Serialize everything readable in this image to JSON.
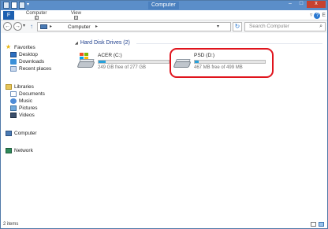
{
  "window": {
    "title": "Computer"
  },
  "ribbon": {
    "file_label": "F",
    "tabs": [
      {
        "label": "Computer",
        "keytip": "C"
      },
      {
        "label": "View",
        "keytip": "V"
      }
    ],
    "help_keytip": "E"
  },
  "address": {
    "path": [
      "Computer"
    ],
    "search_placeholder": "Search Computer"
  },
  "sidebar": {
    "favorites": {
      "label": "Favorites",
      "items": [
        "Desktop",
        "Downloads",
        "Recent places"
      ]
    },
    "libraries": {
      "label": "Libraries",
      "items": [
        "Documents",
        "Music",
        "Pictures",
        "Videos"
      ]
    },
    "computer": "Computer",
    "network": "Network"
  },
  "content": {
    "group_header": "Hard Disk Drives (2)",
    "drives": [
      {
        "name": "ACER (C:)",
        "free_text": "249 GB free of 277 GB",
        "used_fraction": 0.1,
        "has_windows_logo": true
      },
      {
        "name": "PSD (D:)",
        "free_text": "467 MB free of 499 MB",
        "used_fraction": 0.06,
        "has_windows_logo": false
      }
    ]
  },
  "status": {
    "item_count": "2 items"
  },
  "colors": {
    "titlebar": "#5b8ec9",
    "usage_bar": "#26a0da",
    "highlight_ring": "#e0141d",
    "group_header": "#1e3e8c"
  }
}
